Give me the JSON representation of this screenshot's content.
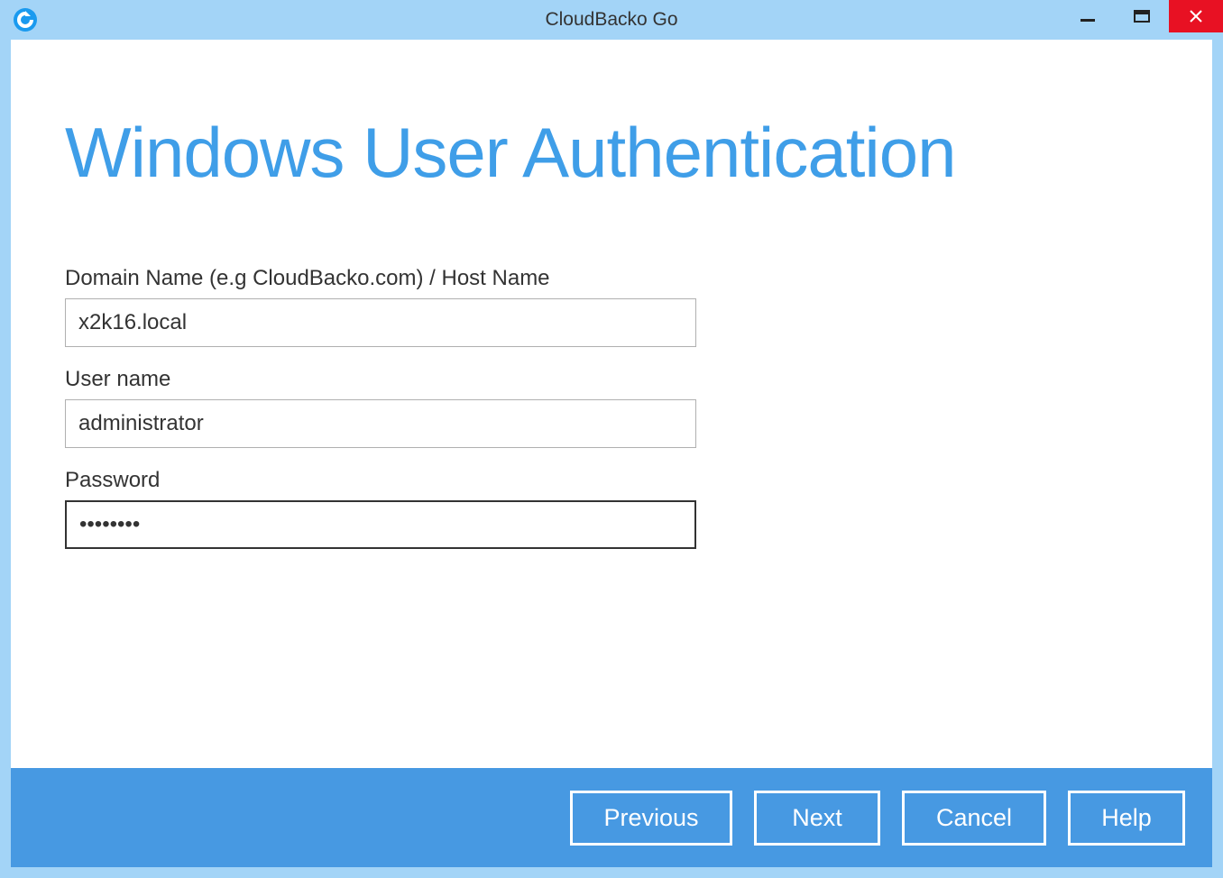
{
  "titlebar": {
    "title": "CloudBacko Go"
  },
  "page": {
    "heading": "Windows User Authentication"
  },
  "form": {
    "domain": {
      "label": "Domain Name (e.g CloudBacko.com) / Host Name",
      "value": "x2k16.local"
    },
    "username": {
      "label": "User name",
      "value": "administrator"
    },
    "password": {
      "label": "Password",
      "value": "••••••••"
    }
  },
  "footer": {
    "previous": "Previous",
    "next": "Next",
    "cancel": "Cancel",
    "help": "Help"
  }
}
